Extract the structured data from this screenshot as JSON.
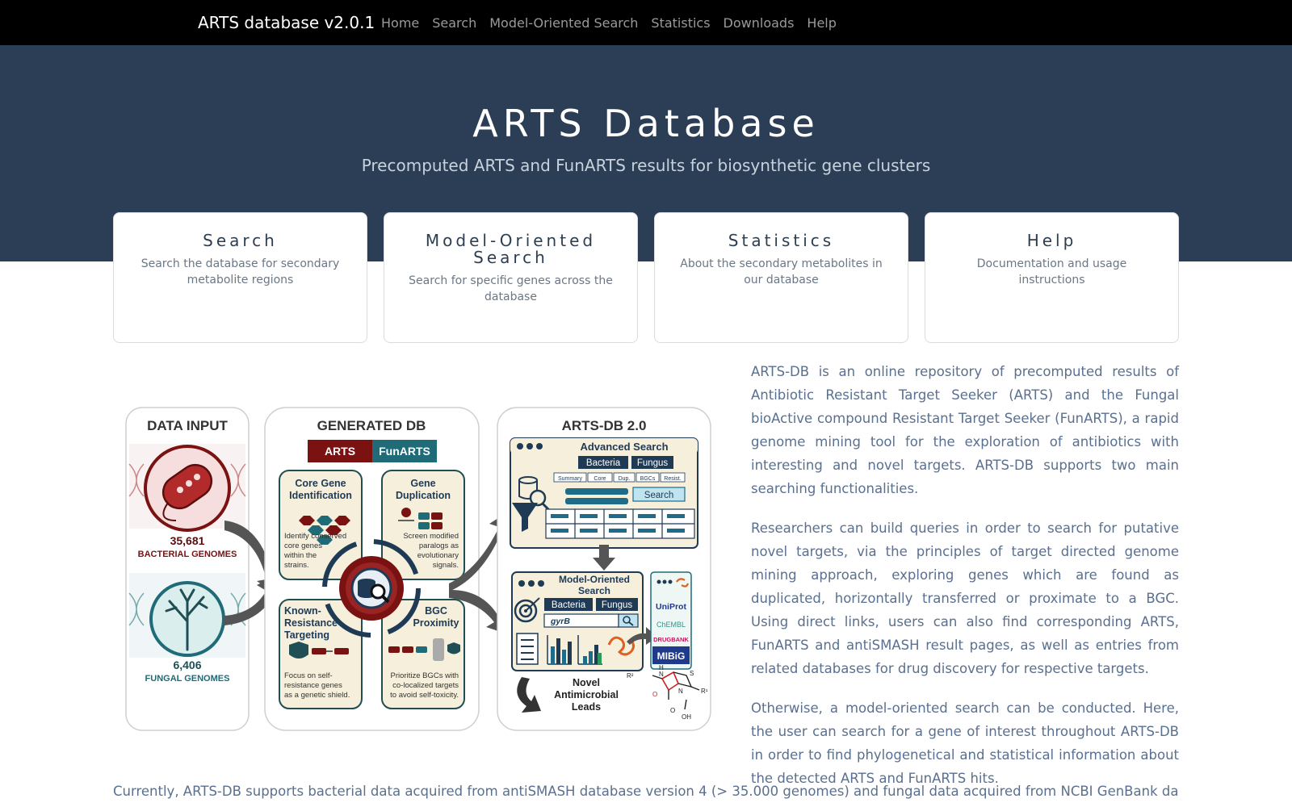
{
  "navbar": {
    "brand": "ARTS database v2.0.1",
    "links": [
      "Home",
      "Search",
      "Model-Oriented Search",
      "Statistics",
      "Downloads",
      "Help"
    ]
  },
  "hero": {
    "title": "ARTS Database",
    "subtitle": "Precomputed ARTS and FunARTS results for biosynthetic gene clusters"
  },
  "cards": [
    {
      "title": "Search",
      "desc": "Search the database for secondary metabolite regions"
    },
    {
      "title": "Model-Oriented Search",
      "desc": "Search for specific genes across the database"
    },
    {
      "title": "Statistics",
      "desc": "About the secondary metabolites in our database"
    },
    {
      "title": "Help",
      "desc": "Documentation and usage instructions"
    }
  ],
  "diagram": {
    "panel1": {
      "title": "DATA INPUT",
      "bact_count": "35,681",
      "bact_label": "BACTERIAL GENOMES",
      "fungal_count": "6,406",
      "fungal_label": "FUNGAL GENOMES"
    },
    "panel2": {
      "title": "GENERATED DB",
      "tag_arts": "ARTS",
      "tag_funarts": "FunARTS",
      "q1_title_1": "Core Gene",
      "q1_title_2": "Identification",
      "q1_desc_1": "Identify conserved",
      "q1_desc_2": "core genes",
      "q1_desc_3": "within the",
      "q1_desc_4": "strains.",
      "q2_title_1": "Gene",
      "q2_title_2": "Duplication",
      "q2_desc_1": "Screen modified",
      "q2_desc_2": "paralogs as",
      "q2_desc_3": "evolutionary",
      "q2_desc_4": "signals.",
      "q3_title_1": "Known-",
      "q3_title_2": "Resistance",
      "q3_title_3": "Targeting",
      "q3_desc_1": "Focus on self-",
      "q3_desc_2": "resistance genes",
      "q3_desc_3": "as a genetic shield.",
      "q4_title_1": "BGC",
      "q4_title_2": "Proximity",
      "q4_desc_1": "Prioritize BGCs with",
      "q4_desc_2": "co-localized targets",
      "q4_desc_3": "to avoid self-toxicity."
    },
    "panel3": {
      "title": "ARTS-DB 2.0",
      "adv_title": "Advanced Search",
      "bacteria": "Bacteria",
      "fungus": "Fungus",
      "filters": [
        "Summary",
        "Core",
        "Dup.",
        "BGCs",
        "Resist."
      ],
      "search_btn": "Search",
      "mos_title_1": "Model-Oriented",
      "mos_title_2": "Search",
      "gene_query": "gyrB",
      "db_uniprot": "UniProt",
      "db_chembl": "ChEMBL",
      "db_drugbank": "DRUGBANK",
      "db_mibig": "MIBiG",
      "leads_1": "Novel",
      "leads_2": "Antimicrobial",
      "leads_3": "Leads",
      "chem_r1": "R¹",
      "chem_r2": "R²",
      "chem_h": "H",
      "chem_n": "N",
      "chem_s": "S",
      "chem_o": "O",
      "chem_oh": "OH"
    }
  },
  "intro": {
    "p1": "ARTS-DB is an online repository of precomputed results of Antibiotic Resistant Target Seeker (ARTS) and the Fungal bioActive compound Resistant Target Seeker (FunARTS), a rapid genome mining tool for the exploration of antibiotics with interesting and novel targets. ARTS-DB supports two main searching functionalities.",
    "p2": "Researchers can build queries in order to search for putative novel targets, via the principles of target directed genome mining approach, exploring genes which are found as duplicated, horizontally transferred or proximate to a BGC. Using direct links, users can also find corresponding ARTS, FunARTS and antiSMASH result pages, as well as entries from related databases for drug discovery for respective targets.",
    "p3": "Otherwise, a model-oriented search can be conducted. Here, the user can search for a gene of interest throughout ARTS-DB in order to find phylogenetical and statistical information about the detected ARTS and FunARTS hits."
  },
  "bottom_text": "Currently, ARTS-DB supports bacterial data acquired from antiSMASH database version 4 (> 35.000 genomes) and fungal data acquired from NCBI GenBank database Release",
  "colors": {
    "navbar": "#000000",
    "hero": "#2c3e55",
    "text_blue": "#5a7090",
    "dark_red": "#7a1212",
    "teal": "#1f6b78",
    "cream": "#f5efdc"
  }
}
